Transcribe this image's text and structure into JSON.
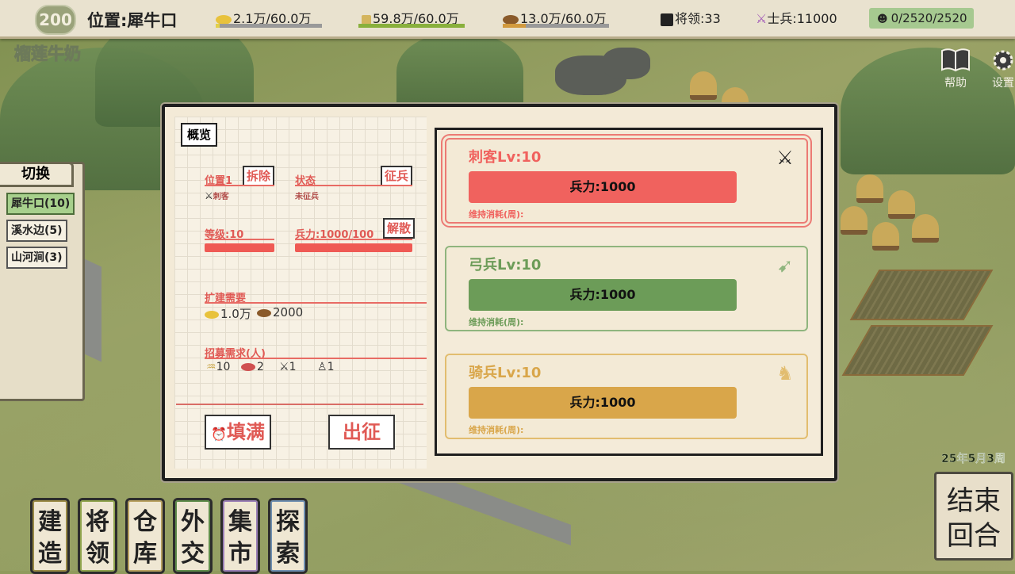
{
  "topbar": {
    "level": "200",
    "location": "位置:犀牛口",
    "gold": "2.1万/60.0万",
    "gold_fill": 0.035,
    "food": "59.8万/60.0万",
    "food_fill": 0.997,
    "wood": "13.0万/60.0万",
    "wood_fill": 0.217,
    "generals": "将领:33",
    "soldiers": "士兵:11000",
    "population": "0/2520/2520",
    "colors": {
      "gold_bar": "#e2d04a",
      "food_bar": "#89b03c",
      "wood_bar": "#d29a3e"
    }
  },
  "player_name": "榴莲牛奶",
  "side_buttons": {
    "help": "帮助",
    "settings": "设置"
  },
  "switch_panel": {
    "title": "切换",
    "locations": [
      "犀牛口(10)",
      "溪水边(5)",
      "山河涧(3)"
    ]
  },
  "overview": {
    "tab": "概览",
    "position_label": "位置1",
    "position_unit": "刺客",
    "remove_btn": "拆除",
    "status_label": "状态",
    "status_value": "未征兵",
    "recruit_btn": "征兵",
    "level_label": "等级:10",
    "troops_label": "兵力:1000/100",
    "disband_btn": "解散",
    "expand_label": "扩建需要",
    "expand_gold": "1.0万",
    "expand_wood": "2000",
    "recruit_req_label": "招募需求(人)",
    "req_food": "10",
    "req_meat": "2",
    "req_weapon": "1",
    "req_person": "1",
    "fill_btn": "填满",
    "march_btn": "出征"
  },
  "units": [
    {
      "name": "刺客Lv:10",
      "troops": "兵力:1000",
      "upkeep": "维持消耗(周):",
      "color": "#f0625e",
      "border": "#ec7a74",
      "icon": "assassin-icon",
      "glyph": "⚔"
    },
    {
      "name": "弓兵Lv:10",
      "troops": "兵力:1000",
      "upkeep": "维持消耗(周):",
      "color": "#6c9c58",
      "border": "#8fb57e",
      "icon": "bow-icon",
      "glyph": "➹"
    },
    {
      "name": "骑兵Lv:10",
      "troops": "兵力:1000",
      "upkeep": "维持消耗(周):",
      "color": "#d9a64a",
      "border": "#e2bd6f",
      "icon": "horse-icon",
      "glyph": "♞"
    }
  ],
  "bottom_menu": [
    {
      "label": "建\n造",
      "color": "#9a8a45"
    },
    {
      "label": "将\n领",
      "color": "#8fa34d"
    },
    {
      "label": "仓\n库",
      "color": "#b8a160"
    },
    {
      "label": "外\n交",
      "color": "#5f8c4a"
    },
    {
      "label": "集\n市",
      "color": "#9a7fb5"
    },
    {
      "label": "探\n索",
      "color": "#6f8fb0"
    }
  ],
  "date": "25年5月3周",
  "end_turn": "结束\n回合"
}
